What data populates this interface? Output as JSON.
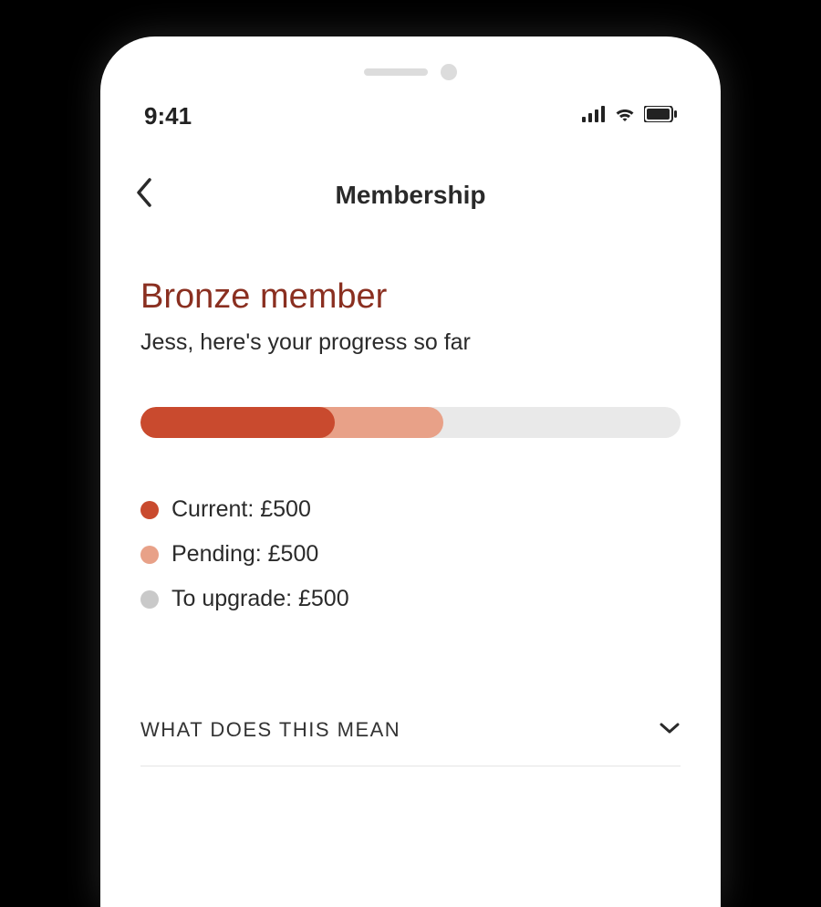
{
  "status": {
    "time": "9:41"
  },
  "nav": {
    "title": "Membership"
  },
  "membership": {
    "tier": "Bronze member",
    "subtitle": "Jess, here's your progress so far",
    "progress": {
      "current_pct": 36,
      "pending_pct": 56
    },
    "legend": {
      "current": {
        "label": "Current: £500",
        "color": "#c94a2e"
      },
      "pending": {
        "label": "Pending: £500",
        "color": "#e8a188"
      },
      "upgrade": {
        "label": "To upgrade: £500",
        "color": "#c9c9c9"
      }
    }
  },
  "accordion": {
    "label": "WHAT DOES THIS MEAN"
  }
}
